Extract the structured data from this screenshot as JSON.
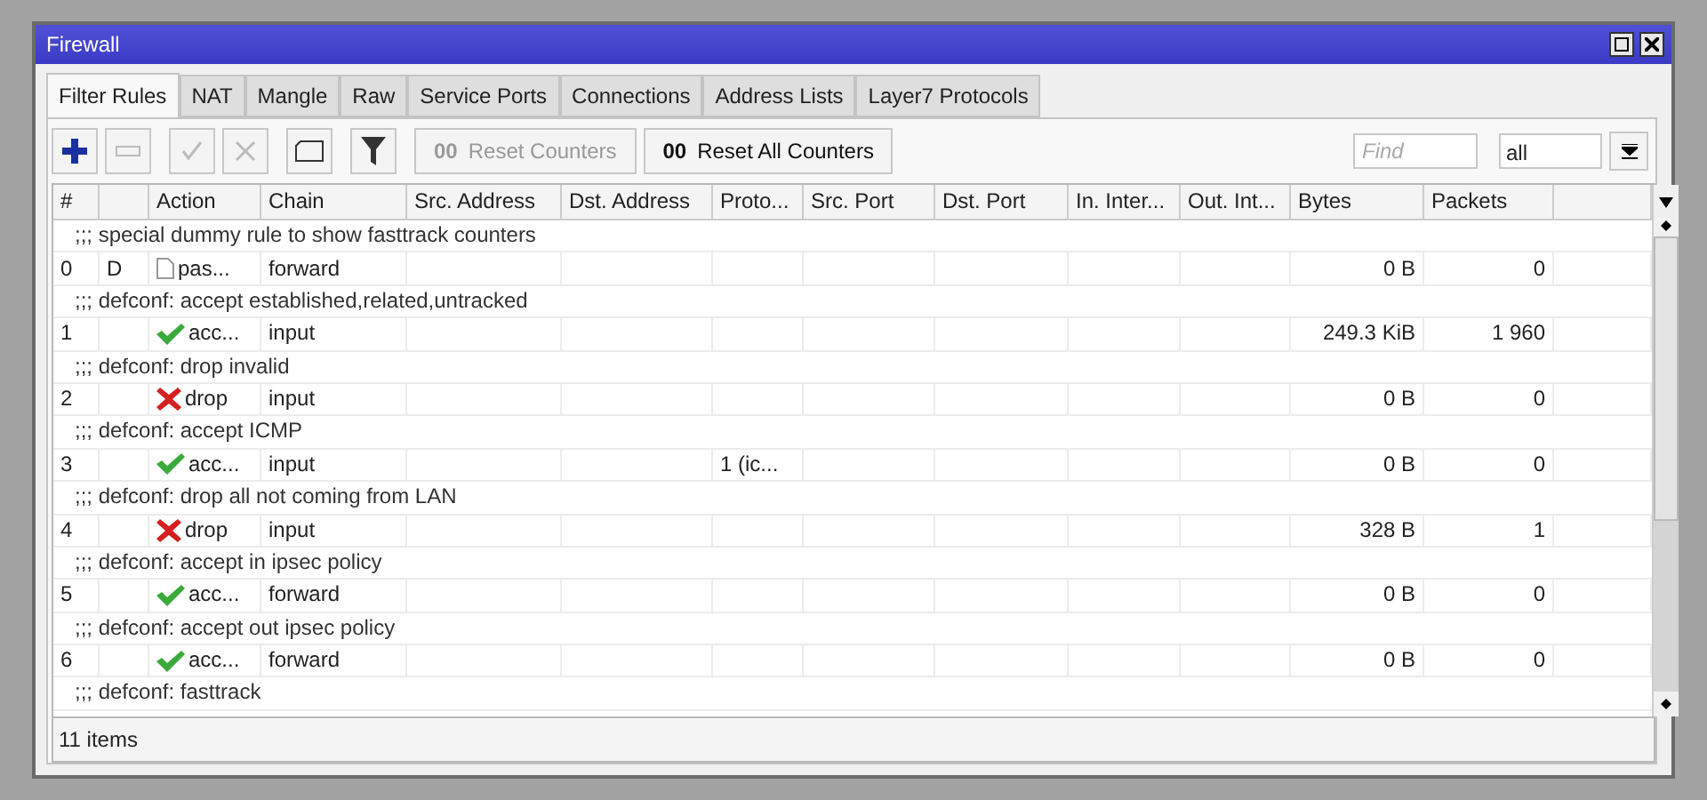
{
  "window": {
    "title": "Firewall"
  },
  "tabs": [
    {
      "label": "Filter Rules",
      "selected": true
    },
    {
      "label": "NAT",
      "selected": false
    },
    {
      "label": "Mangle",
      "selected": false
    },
    {
      "label": "Raw",
      "selected": false
    },
    {
      "label": "Service Ports",
      "selected": false
    },
    {
      "label": "Connections",
      "selected": false
    },
    {
      "label": "Address Lists",
      "selected": false
    },
    {
      "label": "Layer7 Protocols",
      "selected": false
    }
  ],
  "toolbar": {
    "icon_buttons": [
      {
        "kind": "add",
        "disabled": false
      },
      {
        "kind": "remove",
        "disabled": true
      },
      {
        "kind": "enable",
        "disabled": true
      },
      {
        "kind": "disable",
        "disabled": true
      },
      {
        "kind": "comment",
        "disabled": false
      },
      {
        "kind": "filter",
        "disabled": false
      }
    ],
    "text_buttons": [
      {
        "prefix": "00",
        "label": "Reset Counters",
        "disabled": true
      },
      {
        "prefix": "00",
        "label": "Reset All Counters",
        "disabled": false
      }
    ],
    "search": {
      "placeholder": "Find"
    },
    "scope": {
      "value": "all"
    }
  },
  "table": {
    "columns": [
      "#",
      "Action",
      "Chain",
      "Src. Address",
      "Dst. Address",
      "Proto...",
      "Src. Port",
      "Dst. Port",
      "In. Inter...",
      "Out. Int...",
      "Bytes",
      "Packets"
    ],
    "rows": [
      {
        "kind": "comment",
        "text": ";;; special dummy rule to show fasttrack counters"
      },
      {
        "kind": "rule",
        "number": "0",
        "flag": "D",
        "action": {
          "kind": "passthrough",
          "text": "pas..."
        },
        "chain": "forward",
        "bytes": "0 B",
        "packets": "0"
      },
      {
        "kind": "comment",
        "text": ";;; defconf: accept established,related,untracked"
      },
      {
        "kind": "rule",
        "number": "1",
        "action": {
          "kind": "accept",
          "text": "acc..."
        },
        "chain": "input",
        "bytes": "249.3 KiB",
        "packets": "1 960"
      },
      {
        "kind": "comment",
        "text": ";;; defconf: drop invalid"
      },
      {
        "kind": "rule",
        "number": "2",
        "action": {
          "kind": "drop",
          "text": "drop"
        },
        "chain": "input",
        "bytes": "0 B",
        "packets": "0"
      },
      {
        "kind": "comment",
        "text": ";;; defconf: accept ICMP"
      },
      {
        "kind": "rule",
        "number": "3",
        "action": {
          "kind": "accept",
          "text": "acc..."
        },
        "chain": "input",
        "protocol": "1 (ic...",
        "bytes": "0 B",
        "packets": "0"
      },
      {
        "kind": "comment",
        "text": ";;; defconf: drop all not coming from LAN"
      },
      {
        "kind": "rule",
        "number": "4",
        "action": {
          "kind": "drop",
          "text": "drop"
        },
        "chain": "input",
        "bytes": "328 B",
        "packets": "1"
      },
      {
        "kind": "comment",
        "text": ";;; defconf: accept in ipsec policy"
      },
      {
        "kind": "rule",
        "number": "5",
        "action": {
          "kind": "accept",
          "text": "acc..."
        },
        "chain": "forward",
        "bytes": "0 B",
        "packets": "0"
      },
      {
        "kind": "comment",
        "text": ";;; defconf: accept out ipsec policy"
      },
      {
        "kind": "rule",
        "number": "6",
        "action": {
          "kind": "accept",
          "text": "acc..."
        },
        "chain": "forward",
        "bytes": "0 B",
        "packets": "0"
      },
      {
        "kind": "comment",
        "text": ";;; defconf: fasttrack"
      }
    ]
  },
  "status_bar": {
    "text": "11 items"
  }
}
